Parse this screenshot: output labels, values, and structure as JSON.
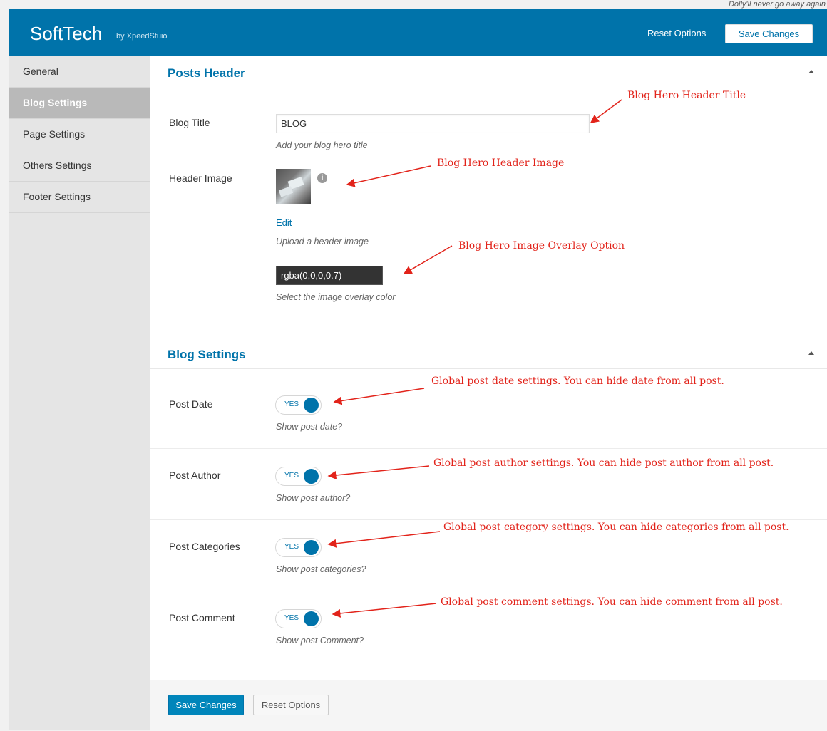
{
  "top_note": "Dolly'll never go away again",
  "header": {
    "brand": "SoftTech",
    "brand_sub": "by XpeedStuio",
    "reset_label": "Reset Options",
    "save_label": "Save Changes",
    "color": "#0073aa"
  },
  "sidebar": {
    "items": [
      {
        "label": "General",
        "active": false
      },
      {
        "label": "Blog Settings",
        "active": true
      },
      {
        "label": "Page Settings",
        "active": false
      },
      {
        "label": "Others Settings",
        "active": false
      },
      {
        "label": "Footer Settings",
        "active": false
      }
    ]
  },
  "posts_header": {
    "title": "Posts Header",
    "blog_title": {
      "label": "Blog Title",
      "value": "BLOG",
      "desc": "Add your blog hero title"
    },
    "header_image": {
      "label": "Header Image",
      "edit": "Edit",
      "desc": "Upload a header image",
      "info_icon": "i"
    },
    "overlay": {
      "value": "rgba(0,0,0,0.7)",
      "desc": "Select the image overlay color"
    }
  },
  "blog_settings": {
    "title": "Blog Settings",
    "rows": [
      {
        "label": "Post Date",
        "toggle": "YES",
        "desc": "Show post date?"
      },
      {
        "label": "Post Author",
        "toggle": "YES",
        "desc": "Show post author?"
      },
      {
        "label": "Post Categories",
        "toggle": "YES",
        "desc": "Show post categories?"
      },
      {
        "label": "Post Comment",
        "toggle": "YES",
        "desc": "Show post Comment?"
      }
    ]
  },
  "footer": {
    "save_label": "Save Changes",
    "reset_label": "Reset Options"
  },
  "annotations": [
    "Blog Hero Header Title",
    "Blog Hero Header Image",
    "Blog Hero Image Overlay Option",
    "Global post date settings. You can hide date from all post.",
    "Global post author settings. You can hide post author from all post.",
    "Global post category settings. You can hide categories from all post.",
    "Global post comment settings. You can hide comment from all post."
  ]
}
